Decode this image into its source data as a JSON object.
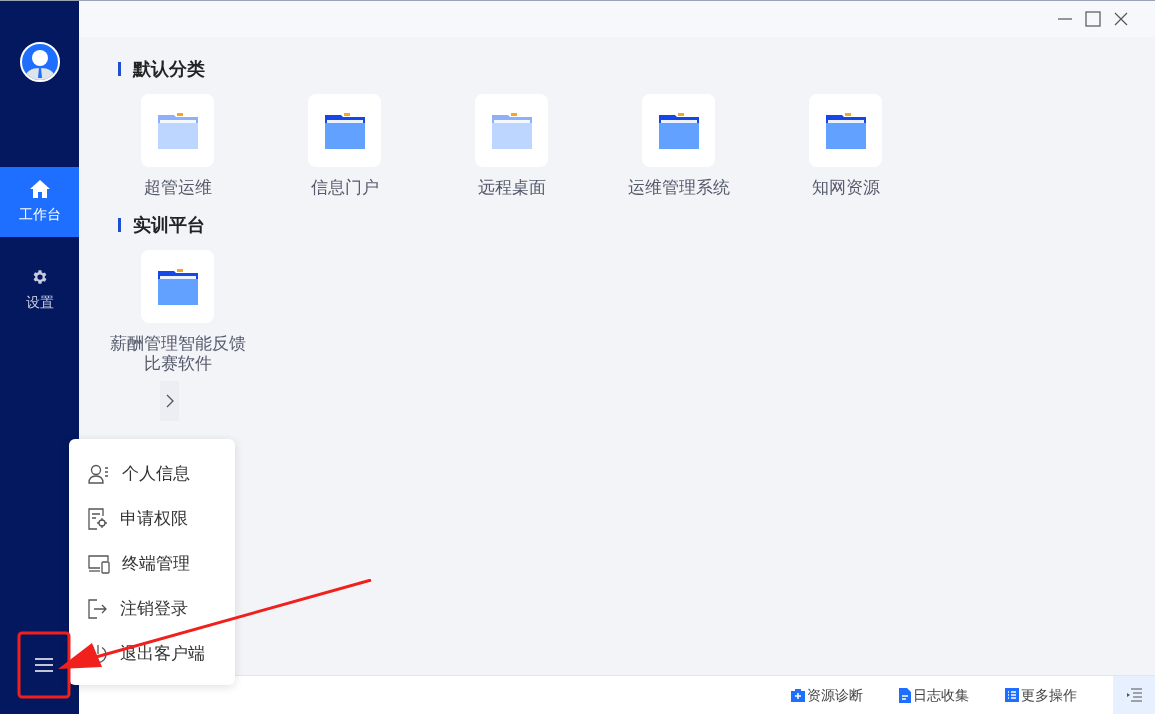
{
  "sidebar": {
    "items": [
      {
        "label": "工作台",
        "kind": "home",
        "selected": true
      },
      {
        "label": "设置",
        "kind": "gear",
        "selected": false
      }
    ]
  },
  "sections": [
    {
      "title": "默认分类",
      "apps": [
        {
          "label": "超管运维",
          "kind": "light"
        },
        {
          "label": "信息门户",
          "kind": "dark"
        },
        {
          "label": "远程桌面",
          "kind": "light"
        },
        {
          "label": "运维管理系统",
          "kind": "dark"
        },
        {
          "label": "知网资源",
          "kind": "dark"
        }
      ]
    },
    {
      "title": "实训平台",
      "apps": [
        {
          "label": "薪酬管理智能反馈比赛软件",
          "kind": "dark"
        }
      ]
    }
  ],
  "menu": {
    "items": [
      {
        "label": "个人信息",
        "kind": "user"
      },
      {
        "label": "申请权限",
        "kind": "request"
      },
      {
        "label": "终端管理",
        "kind": "devices"
      },
      {
        "label": "注销登录",
        "kind": "logout"
      },
      {
        "label": "退出客户端",
        "kind": "quit"
      }
    ]
  },
  "status_bar": {
    "items": [
      {
        "label": "资源诊断",
        "kind": "diagnose"
      },
      {
        "label": "日志收集",
        "kind": "logs"
      },
      {
        "label": "更多操作",
        "kind": "more"
      }
    ]
  }
}
